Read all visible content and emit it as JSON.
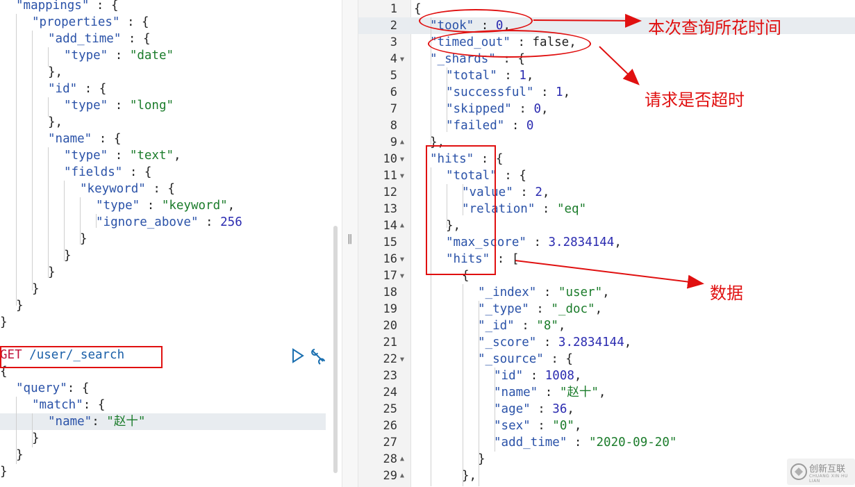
{
  "left_editor": {
    "mapping_lines": [
      [
        "p",
        "\"mappings\" : {"
      ],
      [
        "p",
        "\"properties\" : {"
      ],
      [
        "p",
        "\"add_time\" : {"
      ],
      [
        "kv",
        "\"type\"",
        "\"date\""
      ],
      [
        "p",
        "},"
      ],
      [
        "p",
        "\"id\" : {"
      ],
      [
        "kv",
        "\"type\"",
        "\"long\""
      ],
      [
        "p",
        "},"
      ],
      [
        "p",
        "\"name\" : {"
      ],
      [
        "kv",
        "\"type\"",
        "\"text\","
      ],
      [
        "p",
        "\"fields\" : {"
      ],
      [
        "p",
        "\"keyword\" : {"
      ],
      [
        "kv",
        "\"type\"",
        "\"keyword\","
      ],
      [
        "kvn",
        "\"ignore_above\"",
        "256"
      ],
      [
        "p",
        "}"
      ],
      [
        "p",
        "}"
      ],
      [
        "p",
        "}"
      ],
      [
        "p",
        "}"
      ],
      [
        "p",
        "}"
      ],
      [
        "p",
        "}"
      ]
    ],
    "request": {
      "method": "GET",
      "path": "/user/_search",
      "body_lines": [
        [
          "p",
          "{"
        ],
        [
          "p",
          "\"query\": {"
        ],
        [
          "p",
          "\"match\": {"
        ],
        [
          "kv2",
          "\"name\"",
          "\"赵十\""
        ],
        [
          "p",
          "}"
        ],
        [
          "p",
          "}"
        ],
        [
          "p",
          "}"
        ]
      ]
    },
    "run_icon": "play-triangle-icon",
    "wrench_icon": "wrench-settings-icon"
  },
  "right_editor": {
    "line_numbers": [
      "1",
      "2",
      "3",
      "4",
      "5",
      "6",
      "7",
      "8",
      "9",
      "10",
      "11",
      "12",
      "13",
      "14",
      "15",
      "16",
      "17",
      "18",
      "19",
      "20",
      "21",
      "22",
      "23",
      "24",
      "25",
      "26",
      "27",
      "28",
      "29"
    ],
    "fold_lines": [
      "4",
      "9",
      "10",
      "11",
      "14",
      "16",
      "17",
      "22",
      "28",
      "29"
    ],
    "response_lines": [
      "{",
      "\"took\" : 0,",
      "\"timed_out\" : false,",
      "\"_shards\" : {",
      "\"total\" : 1,",
      "\"successful\" : 1,",
      "\"skipped\" : 0,",
      "\"failed\" : 0",
      "},",
      "\"hits\" : {",
      "\"total\" : {",
      "\"value\" : 2,",
      "\"relation\" : \"eq\"",
      "},",
      "\"max_score\" : 3.2834144,",
      "\"hits\" : [",
      "{",
      "\"_index\" : \"user\",",
      "\"_type\" : \"_doc\",",
      "\"_id\" : \"8\",",
      "\"_score\" : 3.2834144,",
      "\"_source\" : {",
      "\"id\" : 1008,",
      "\"name\" : \"赵十\",",
      "\"age\" : 36,",
      "\"sex\" : \"0\",",
      "\"add_time\" : \"2020-09-20\"",
      "}",
      "},"
    ]
  },
  "annotations": {
    "took_label": "本次查询所花时间",
    "timed_out_label": "请求是否超时",
    "hits_label": "数据"
  },
  "divider": {
    "grip": "||"
  },
  "watermark": {
    "brand": "创新互联",
    "sub": "CHUANG XIN HU LIAN"
  },
  "colors": {
    "annotation_red": "#e01010",
    "key_blue": "#2a52a8",
    "string_green": "#1b7c2b",
    "number_blue": "#2b2bb0",
    "method_red": "#c0143c"
  }
}
